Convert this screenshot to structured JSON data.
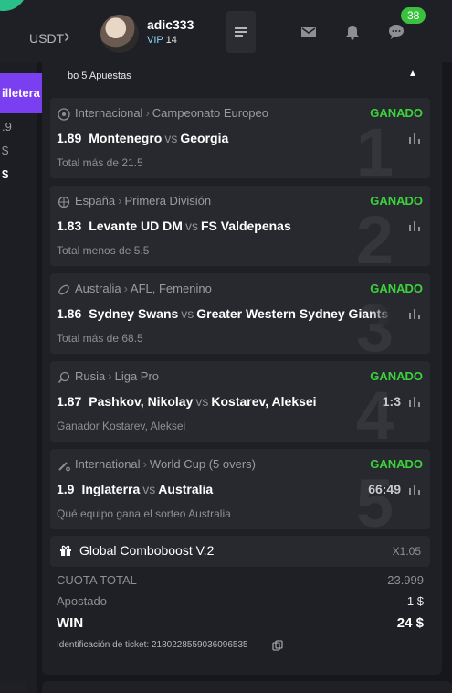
{
  "header": {
    "currency": "USDT",
    "username": "adic333",
    "vip_prefix": "VIP",
    "vip_level": "14",
    "notifications_count": "38"
  },
  "sidebar": {
    "wallet_label": "illetera",
    "values": [
      ".9",
      "$",
      "$"
    ]
  },
  "panel": {
    "title": "bo 5 Apuestas"
  },
  "bets": [
    {
      "sport_icon": "soccer-icon",
      "country": "Internacional",
      "league": "Campeonato Europeo",
      "status": "GANADO",
      "odds": "1.89",
      "home": "Montenegro",
      "away": "Georgia",
      "market": "Total más de 21.5",
      "index": "1",
      "score": ""
    },
    {
      "sport_icon": "basketball-icon",
      "country": "España",
      "league": "Primera División",
      "status": "GANADO",
      "odds": "1.83",
      "home": "Levante UD DM",
      "away": "FS Valdepenas",
      "market": "Total menos de 5.5",
      "index": "2",
      "score": ""
    },
    {
      "sport_icon": "rugby-ball-icon",
      "country": "Australia",
      "league": "AFL, Femenino",
      "status": "GANADO",
      "odds": "1.86",
      "home": "Sydney Swans",
      "away": "Greater Western Sydney Giants",
      "market": "Total más de 68.5",
      "index": "3",
      "score": ""
    },
    {
      "sport_icon": "table-tennis-icon",
      "country": "Rusia",
      "league": "Liga Pro",
      "status": "GANADO",
      "odds": "1.87",
      "home": "Pashkov, Nikolay",
      "away": "Kostarev, Aleksei",
      "market": "Ganador Kostarev, Aleksei",
      "index": "4",
      "score": "1:3"
    },
    {
      "sport_icon": "cricket-icon",
      "country": "International",
      "league": "World Cup (5 overs)",
      "status": "GANADO",
      "odds": "1.9",
      "home": "Inglaterra",
      "away": "Australia",
      "market": "Qué equipo gana el sorteo Australia",
      "index": "5",
      "score": "66:49"
    }
  ],
  "vs": "vs",
  "combo": {
    "label": "Global Comboboost V.2",
    "multiplier": "X1.05"
  },
  "summary": {
    "total_odds_label": "CUOTA TOTAL",
    "total_odds": "23.999",
    "stake_label": "Apostado",
    "stake": "1 $",
    "win_label": "WIN",
    "win": "24 $"
  },
  "ticket": {
    "text": "Identificación de ticket: 2180228559036096535"
  },
  "colors": {
    "won": "#3ad33a",
    "accent": "#7b3ff2",
    "badge": "#3ac23f"
  }
}
